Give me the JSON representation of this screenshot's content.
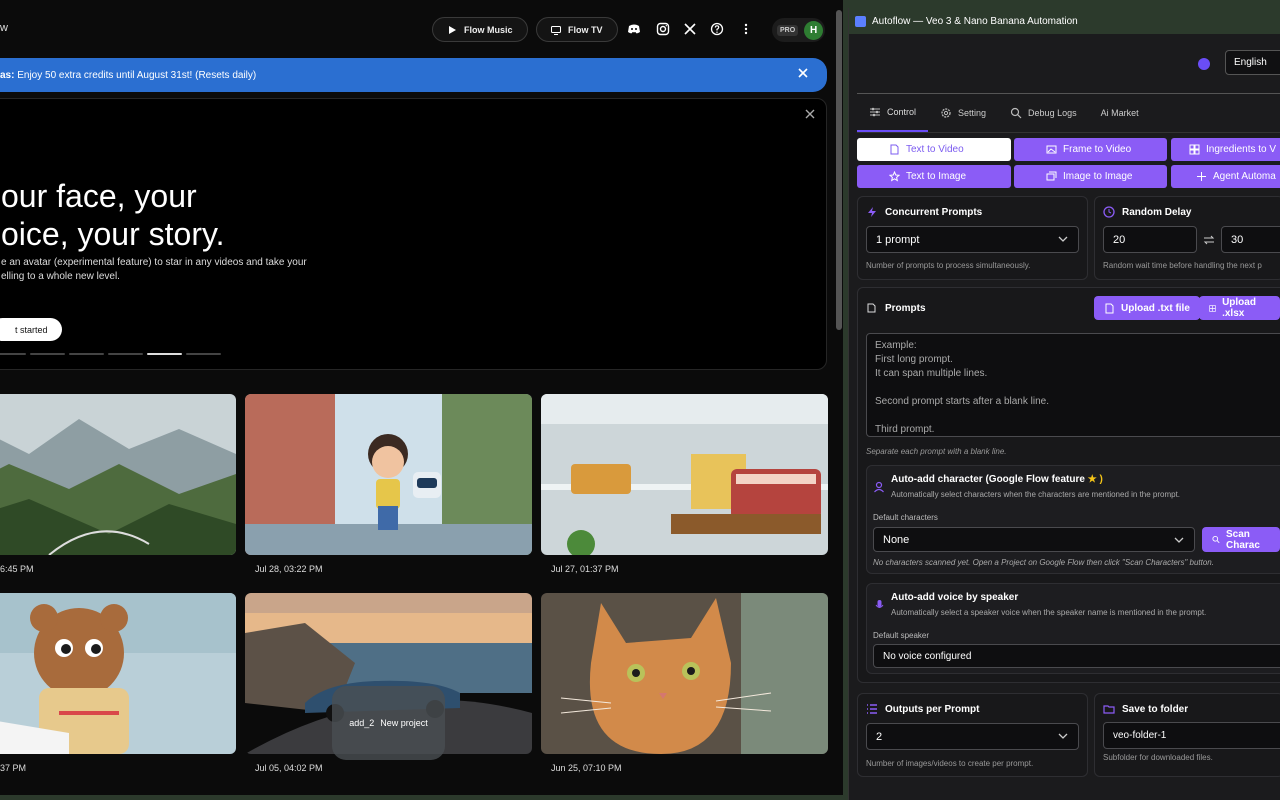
{
  "flow": {
    "logo_fragment": "w",
    "nav": {
      "music": "Flow Music",
      "tv": "Flow TV",
      "pro_badge": "PRO",
      "avatar_initial": "H"
    },
    "banner": {
      "prefix": "as:",
      "text": " Enjoy 50 extra credits until August 31st! (Resets daily)"
    },
    "hero": {
      "headline": "our face, your\noice, your story.",
      "body": "e an avatar (experimental feature) to star in any videos and take your elling to a whole new level.",
      "cta": "t started"
    },
    "projects": [
      {
        "date": "6:45 PM",
        "subject": "mountain-valley"
      },
      {
        "date": "Jul 28, 03:22 PM",
        "subject": "boy-robot-store"
      },
      {
        "date": "Jul 27, 01:37 PM",
        "subject": "fridge-food"
      },
      {
        "date": "37 PM",
        "subject": "bear-brushing"
      },
      {
        "date": "Jul 05, 04:02 PM",
        "subject": "car-coast"
      },
      {
        "date": "Jun 25, 07:10 PM",
        "subject": "orange-cat"
      }
    ],
    "new_project": {
      "icon_text": "add_2",
      "label": "New project"
    }
  },
  "autoflow": {
    "window_title": "Autoflow — Veo 3 & Nano Banana Automation",
    "language": "English",
    "tabs": [
      "Control",
      "Setting",
      "Debug Logs",
      "Ai Market"
    ],
    "modes": [
      "Text to Video",
      "Frame to Video",
      "Ingredients to V",
      "Text to Image",
      "Image to Image",
      "Agent Automa"
    ],
    "concurrent": {
      "label": "Concurrent Prompts",
      "value": "1 prompt",
      "hint": "Number of prompts to process simultaneously."
    },
    "delay": {
      "label": "Random Delay",
      "min": "20",
      "max": "30",
      "hint": "Random wait time before handling the next p"
    },
    "prompts": {
      "label": "Prompts",
      "upload_txt": "Upload .txt file",
      "upload_xlsx": "Upload .xlsx",
      "placeholder": "Example:\nFirst long prompt.\nIt can span multiple lines.\n\nSecond prompt starts after a blank line.\n\nThird prompt.",
      "hint": "Separate each prompt with a blank line."
    },
    "character": {
      "title": "Auto-add character (Google Flow feature",
      "star": "★ )",
      "desc": "Automatically select characters when the characters are mentioned in the prompt.",
      "default_label": "Default characters",
      "value": "None",
      "scan": "Scan Charac",
      "note": "No characters scanned yet. Open a Project on Google Flow then click \"Scan Characters\" button."
    },
    "voice": {
      "title": "Auto-add voice by speaker",
      "desc": "Automatically select a speaker voice when the speaker name is mentioned in the prompt.",
      "default_label": "Default speaker",
      "value": "No voice configured"
    },
    "outputs": {
      "label": "Outputs per Prompt",
      "value": "2",
      "hint": "Number of images/videos to create per prompt."
    },
    "folder": {
      "label": "Save to folder",
      "value": "veo-folder-1",
      "hint": "Subfolder for downloaded files."
    }
  },
  "colors": {
    "accent": "#8b5cf6",
    "banner": "#2b6fd1",
    "avatar": "#2e7d32"
  }
}
